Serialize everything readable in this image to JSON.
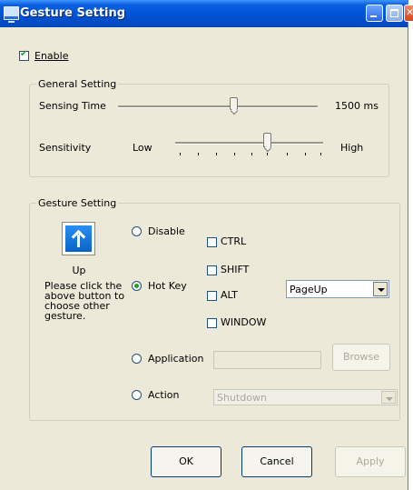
{
  "window": {
    "title": "Gesture Setting"
  },
  "enable": {
    "label": "Enable",
    "checked": true
  },
  "general_setting": {
    "group_label": "General Setting",
    "sensing_time": {
      "label": "Sensing Time",
      "value": "1500 ms"
    },
    "sensitivity": {
      "label": "Sensitivity",
      "low_label": "Low",
      "high_label": "High"
    }
  },
  "gesture_setting": {
    "group_label": "Gesture Setting",
    "gesture_name": "Up",
    "gesture_icon": "up-arrow-icon",
    "help_text": "Please click the above button to choose other gesture.",
    "options": {
      "disable_label": "Disable",
      "hotkey_label": "Hot Key",
      "application_label": "Application",
      "action_label": "Action",
      "selected": "Hot Key"
    },
    "modifiers": {
      "ctrl_label": "CTRL",
      "shift_label": "SHIFT",
      "alt_label": "ALT",
      "window_label": "WINDOW"
    },
    "hotkey_value": "PageUp",
    "application_path": "",
    "browse_label": "Browse",
    "action_value": "Shutdown"
  },
  "buttons": {
    "ok_label": "OK",
    "cancel_label": "Cancel",
    "apply_label": "Apply"
  },
  "colors": {
    "titlebar": "#0053d6",
    "dialog_bg": "#ece9d8",
    "check_accent": "#21a121",
    "gesture_button": "#0a63c8"
  }
}
